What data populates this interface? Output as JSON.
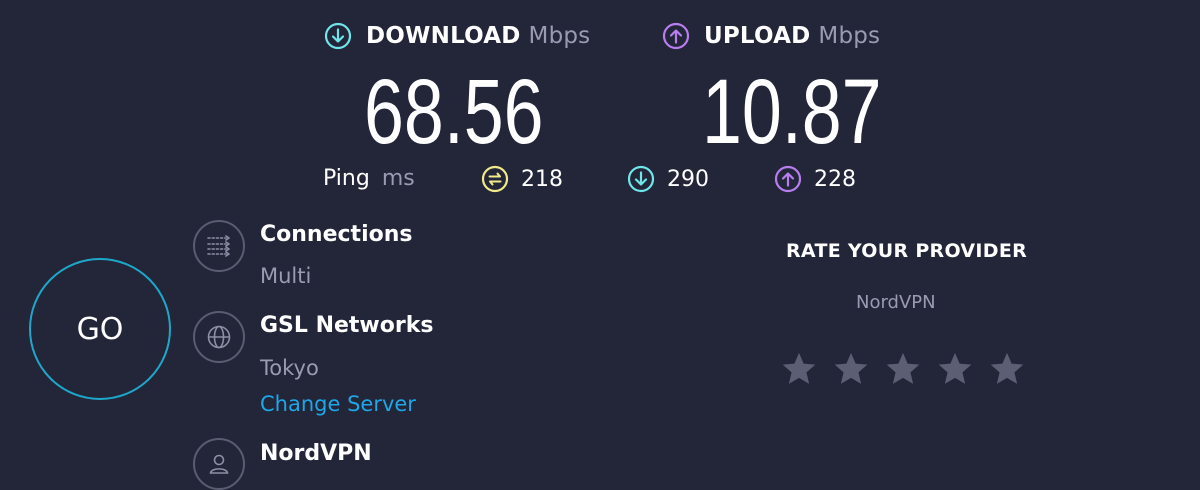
{
  "download": {
    "label": "DOWNLOAD",
    "unit": "Mbps",
    "value": "68.56"
  },
  "upload": {
    "label": "UPLOAD",
    "unit": "Mbps",
    "value": "10.87"
  },
  "ping": {
    "label": "Ping",
    "unit": "ms",
    "idle": "218",
    "download": "290",
    "upload": "228"
  },
  "go_label": "GO",
  "connections": {
    "title": "Connections",
    "value": "Multi"
  },
  "server": {
    "title": "GSL Networks",
    "location": "Tokyo",
    "change_label": "Change Server"
  },
  "provider": {
    "title": "NordVPN"
  },
  "rate": {
    "title": "RATE YOUR PROVIDER",
    "provider": "NordVPN",
    "stars": 5,
    "rating": 0
  },
  "colors": {
    "background": "#232538",
    "download_accent": "#6fe6ea",
    "upload_accent": "#b77ef0",
    "idle_ping_accent": "#f1ea8a",
    "link": "#1ea7e8",
    "go_ring": "#1ea7c9"
  },
  "icons": {
    "download": "arrow-down-circle-icon",
    "upload": "arrow-up-circle-icon",
    "idle": "idle-ping-icon",
    "connections": "connections-icon",
    "server": "globe-icon",
    "provider": "user-icon",
    "star": "star-icon"
  }
}
